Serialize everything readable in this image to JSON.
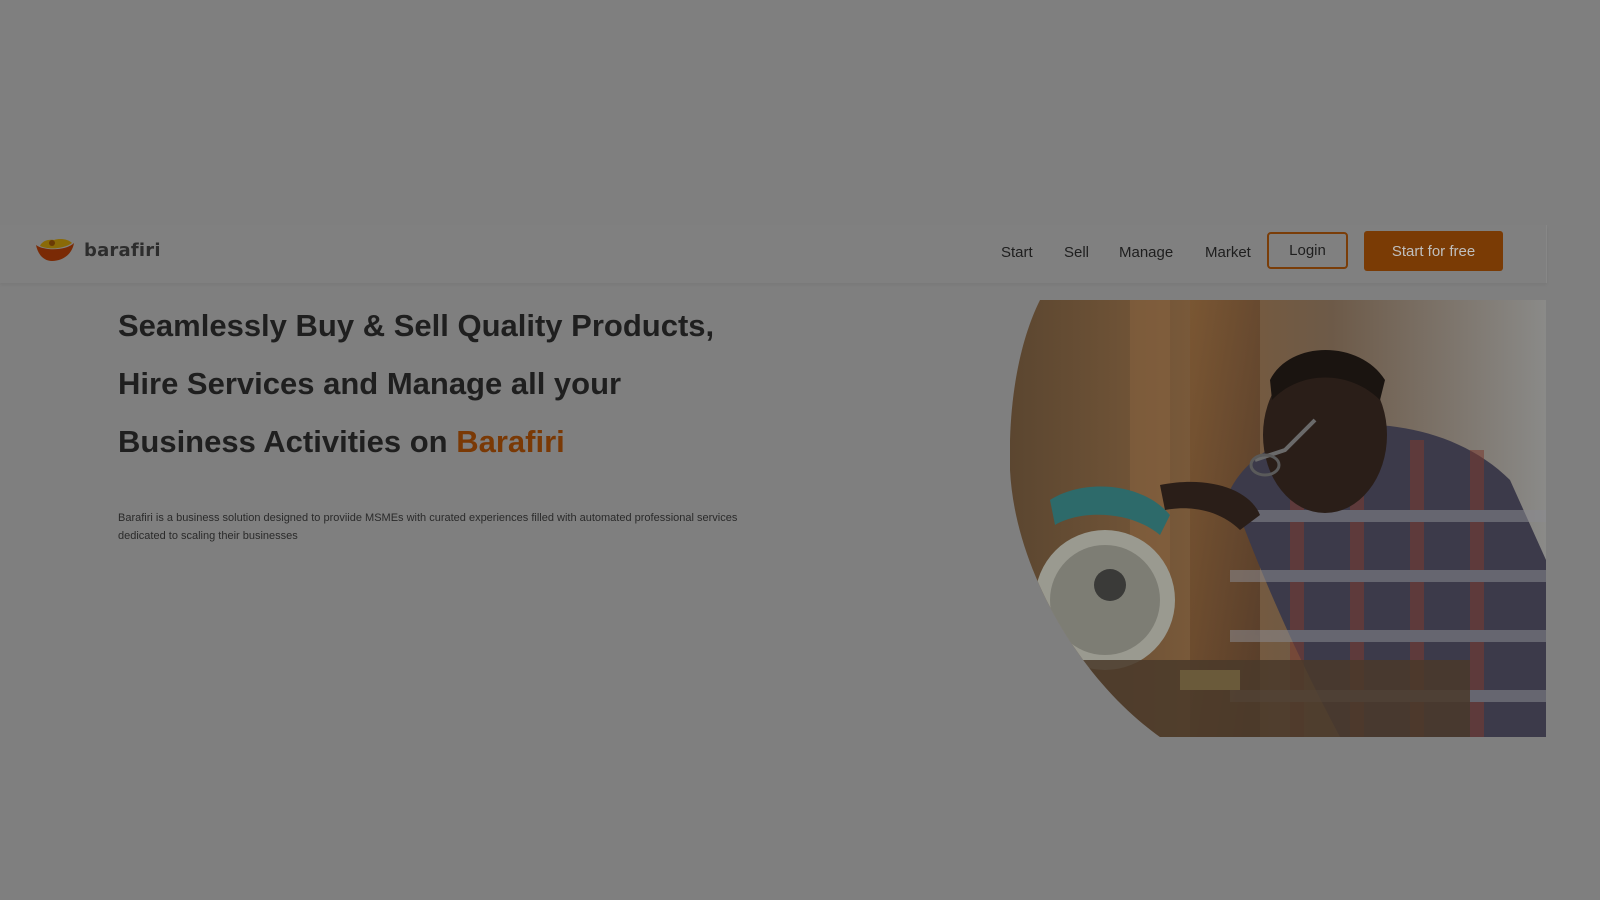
{
  "brand": {
    "name": "barafiri",
    "logo_icon": "bowl-logo-icon",
    "colors": {
      "accent": "#7a3b05",
      "logo_top": "#8a6a08",
      "logo_bottom": "#7a2a05"
    }
  },
  "nav": {
    "items": [
      {
        "label": "Start"
      },
      {
        "label": "Sell"
      },
      {
        "label": "Manage"
      },
      {
        "label": "Market"
      }
    ],
    "login_label": "Login",
    "cta_label": "Start for free"
  },
  "hero": {
    "title_line1": "Seamlessly Buy & Sell Quality Products,",
    "title_line2": "Hire Services and Manage all your",
    "title_line3_prefix": "Business Activities on ",
    "title_brand": "Barafiri",
    "description": "Barafiri is a business solution designed to proviide MSMEs with curated experiences filled with automated professional services dedicated to scaling their businesses"
  }
}
